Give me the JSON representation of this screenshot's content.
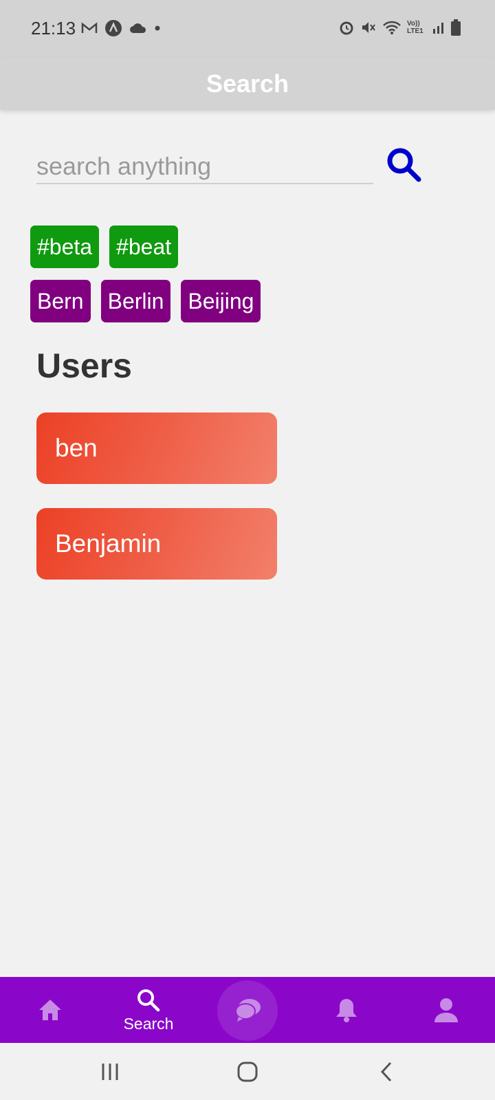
{
  "status_bar": {
    "time": "21:13",
    "left_icons": [
      "gmail-icon",
      "app-a-icon",
      "cloud-icon",
      "dot-icon"
    ],
    "right_icons": [
      "alarm-icon",
      "mute-icon",
      "wifi-icon",
      "volte-icon",
      "signal-icon",
      "battery-icon"
    ],
    "volte_label": "Vo)) LTE1"
  },
  "app_bar": {
    "title": "Search"
  },
  "search": {
    "placeholder": "search anything",
    "value": "",
    "button_icon": "search-icon",
    "accent": "#0000cc"
  },
  "hashtag_chips": [
    "#beta",
    "#beat"
  ],
  "place_chips": [
    "Bern",
    "Berlin",
    "Beijing"
  ],
  "colors": {
    "tag_chip": "#0f9a0f",
    "place_chip": "#800080",
    "nav_bar": "#8a07c9",
    "user_card": "#ec4126"
  },
  "users_section": {
    "title": "Users"
  },
  "users": [
    "ben",
    "Benjamin"
  ],
  "bottom_nav": {
    "items": [
      {
        "icon": "home-icon",
        "label": ""
      },
      {
        "icon": "search-icon",
        "label": "Search",
        "active": true
      },
      {
        "icon": "chat-icon",
        "label": ""
      },
      {
        "icon": "bell-icon",
        "label": ""
      },
      {
        "icon": "profile-icon",
        "label": ""
      }
    ]
  },
  "system_nav": [
    "recents-icon",
    "home-circle-icon",
    "back-icon"
  ]
}
